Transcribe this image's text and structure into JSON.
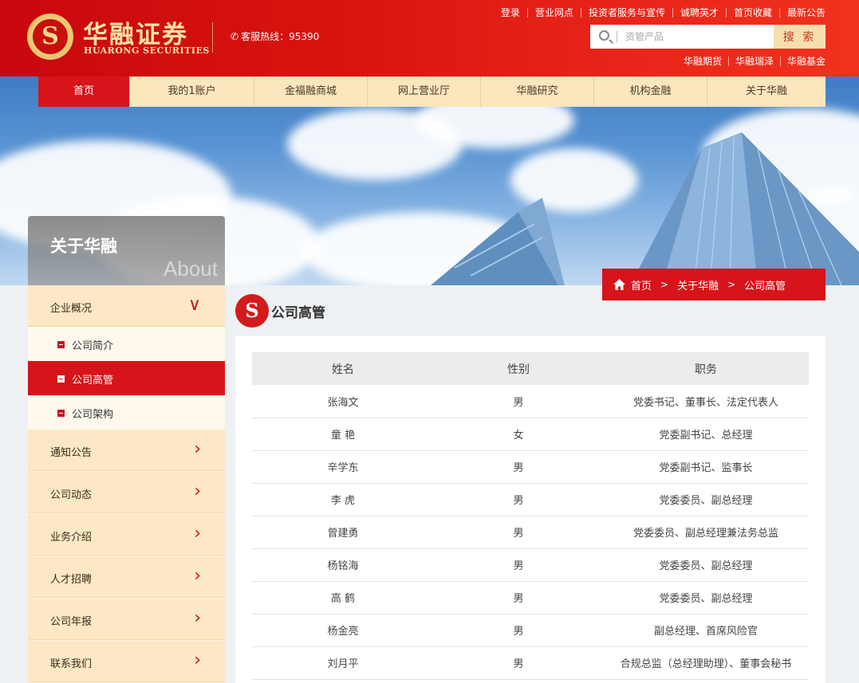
{
  "brand": {
    "logo_cn": "华融证券",
    "logo_en": "HUARONG SECURITIES",
    "logo_glyph": "S",
    "hotline_label": "客服热线：",
    "hotline_number": "95390"
  },
  "toplinks": [
    "登录",
    "营业网点",
    "投资者服务与宣传",
    "诚聘英才",
    "首页收藏",
    "最新公告"
  ],
  "search": {
    "placeholder": "资管产品",
    "button_label": "搜 索"
  },
  "sublinks": [
    "华融期货",
    "华融瑞泽",
    "华融基金"
  ],
  "nav": {
    "items": [
      {
        "label": "首页",
        "active": true
      },
      {
        "label": "我的1账户",
        "active": false
      },
      {
        "label": "金福融商城",
        "active": false
      },
      {
        "label": "网上营业厅",
        "active": false
      },
      {
        "label": "华融研究",
        "active": false
      },
      {
        "label": "机构金融",
        "active": false
      },
      {
        "label": "关于华融",
        "active": false
      }
    ]
  },
  "sidebar": {
    "title_cn": "关于华融",
    "title_en": "About",
    "groups": [
      {
        "label": "企业概况",
        "expanded": true,
        "arrow": "∨"
      },
      {
        "label": "通知公告",
        "arrow": "›"
      },
      {
        "label": "公司动态",
        "arrow": "›"
      },
      {
        "label": "业务介绍",
        "arrow": "›"
      },
      {
        "label": "人才招聘",
        "arrow": "›"
      },
      {
        "label": "公司年报",
        "arrow": "›"
      },
      {
        "label": "联系我们",
        "arrow": "›"
      }
    ],
    "subitems": [
      {
        "label": "公司简介",
        "active": false
      },
      {
        "label": "公司高管",
        "active": true
      },
      {
        "label": "公司架构",
        "active": false
      }
    ]
  },
  "breadcrumb": [
    "首页",
    "关于华融",
    "公司高管"
  ],
  "section": {
    "title": "公司高管",
    "glyph": "S"
  },
  "table": {
    "headers": [
      "姓名",
      "性别",
      "职务"
    ],
    "rows": [
      [
        "张海文",
        "男",
        "党委书记、董事长、法定代表人"
      ],
      [
        "童 艳",
        "女",
        "党委副书记、总经理"
      ],
      [
        "辛学东",
        "男",
        "党委副书记、监事长"
      ],
      [
        "李 虎",
        "男",
        "党委委员、副总经理"
      ],
      [
        "曾建勇",
        "男",
        "党委委员、副总经理兼法务总监"
      ],
      [
        "杨铭海",
        "男",
        "党委委员、副总经理"
      ],
      [
        "高 鹤",
        "男",
        "党委委员、副总经理"
      ],
      [
        "杨金亮",
        "男",
        "副总经理、首席风险官"
      ],
      [
        "刘月平",
        "男",
        "合规总监（总经理助理）、董事会秘书"
      ]
    ]
  },
  "colors": {
    "primary_red": "#d7141a",
    "gold": "#fbe3a6",
    "nav_bg": "#fbe6bd"
  }
}
